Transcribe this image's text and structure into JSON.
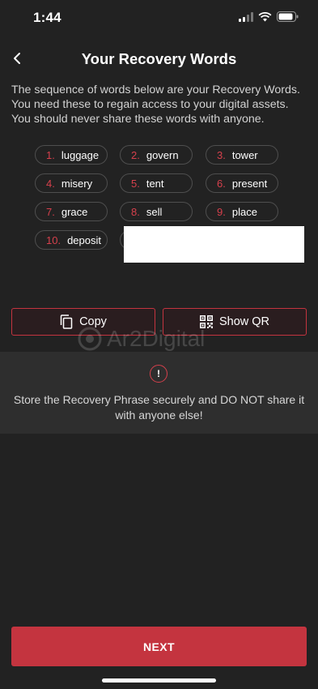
{
  "status_bar": {
    "time": "1:44"
  },
  "header": {
    "title": "Your Recovery Words"
  },
  "description": "The sequence of words below are your Recovery Words. You need these to regain access to your digital assets. You should never share these words with anyone.",
  "recovery_words": [
    {
      "num": "1.",
      "word": "luggage"
    },
    {
      "num": "2.",
      "word": "govern"
    },
    {
      "num": "3.",
      "word": "tower"
    },
    {
      "num": "4.",
      "word": "misery"
    },
    {
      "num": "5.",
      "word": "tent"
    },
    {
      "num": "6.",
      "word": "present"
    },
    {
      "num": "7.",
      "word": "grace"
    },
    {
      "num": "8.",
      "word": "sell"
    },
    {
      "num": "9.",
      "word": "place"
    },
    {
      "num": "10.",
      "word": "deposit"
    }
  ],
  "actions": {
    "copy_label": "Copy",
    "show_qr_label": "Show QR"
  },
  "watermark": "Ar2Digital",
  "warning": {
    "icon_glyph": "!",
    "text": "Store the Recovery Phrase securely and DO NOT share it with anyone else!"
  },
  "next_label": "NEXT",
  "colors": {
    "background": "#222222",
    "accent": "#c4343f",
    "panel": "#2e2e2e"
  }
}
